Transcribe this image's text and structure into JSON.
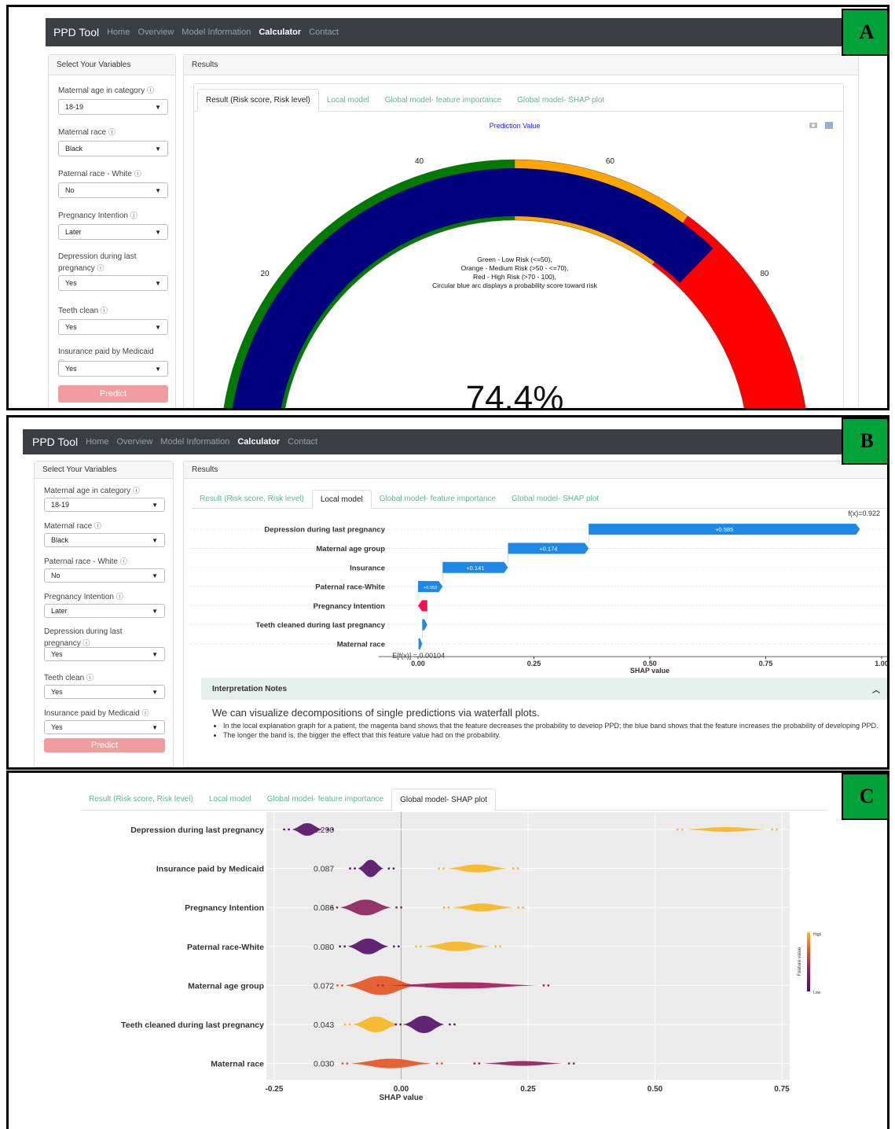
{
  "panels": {
    "a": {
      "letter": "A"
    },
    "b": {
      "letter": "B"
    },
    "c": {
      "letter": "C"
    }
  },
  "navbar": {
    "brand": "PPD Tool",
    "items": [
      "Home",
      "Overview",
      "Model Information",
      "Calculator",
      "Contact"
    ],
    "active": "Calculator"
  },
  "sidebar": {
    "title": "Select Your Variables",
    "info_icon": "ⓘ",
    "fields": [
      {
        "label": "Maternal age in category",
        "value": "18-19"
      },
      {
        "label": "Maternal race",
        "value": "Black"
      },
      {
        "label": "Paternal race - White",
        "value": "No"
      },
      {
        "label": "Pregnancy Intention",
        "value": "Later"
      },
      {
        "label": "Depression during last pregnancy",
        "value": "Yes"
      },
      {
        "label": "Teeth clean",
        "value": "Yes"
      },
      {
        "label": "Insurance paid by Medicaid",
        "value": "Yes"
      }
    ],
    "predict_label": "Predict"
  },
  "results": {
    "title": "Results",
    "tabs": [
      "Result (Risk score, Risk level)",
      "Local model",
      "Global model- feature importance",
      "Global model- SHAP plot"
    ]
  },
  "gauge": {
    "title": "Prediction Value",
    "value": 74.4,
    "value_text": "74.4%",
    "tick_labels": [
      "20",
      "40",
      "60",
      "80"
    ],
    "ranges": [
      {
        "from": 0,
        "to": 50,
        "color": "#007b00"
      },
      {
        "from": 50,
        "to": 70,
        "color": "#ffa500"
      },
      {
        "from": 70,
        "to": 100,
        "color": "#ff0000"
      }
    ],
    "bar_color": "#00007f",
    "legend_lines": [
      "Green - Low Risk (<=50),",
      "Orange - Medium Risk (>50 - <=70),",
      "Red - High Risk (>70 - 100),",
      "Circular blue arc displays a probability score toward risk"
    ],
    "toolbar_icons": [
      "camera-icon",
      "chart-icon"
    ]
  },
  "waterfall": {
    "fx_label": "f(x)=0.922",
    "base_label": "E[f(x)] = 0.00104",
    "xlabel": "SHAP value",
    "ticks": [
      "0.00",
      "0.25",
      "0.50",
      "0.75",
      "1.00"
    ],
    "colors": {
      "positive": "#1e88e5",
      "negative": "#ff0d57"
    }
  },
  "interpretation": {
    "header": "Interpretation Notes",
    "lead": "We can visualize decompositions of single predictions via waterfall plots.",
    "bullets": [
      "In the local explanation graph for a patient, the magenta band shows that the feature decreases the probability to develop PPD; the blue band shows that the feature increases the probability of developing PPD.",
      "The longer the band is, the bigger the effect that this feature value had on the probability."
    ]
  },
  "shap_summary": {
    "xlabel": "SHAP value",
    "ticks": [
      "-0.25",
      "0.00",
      "0.25",
      "0.50",
      "0.75"
    ],
    "colorbar_label": "Feature value",
    "colorbar_high": "High",
    "colorbar_low": "Low"
  },
  "chart_data": [
    {
      "type": "bar",
      "title": "",
      "xlabel": "SHAP value",
      "ylabel": "",
      "base_value": 0.00104,
      "final_value": 0.922,
      "xlim": [
        -0.02,
        1.05
      ],
      "categories": [
        "Depression during last pregnancy",
        "Maternal age group",
        "Insurance",
        "Paternal race-White",
        "Pregnancy Intention",
        "Teeth cleaned during last pregnancy",
        "Maternal race"
      ],
      "values": [
        0.585,
        0.174,
        0.141,
        0.053,
        -0.02,
        0.011,
        0.008
      ],
      "data_labels": [
        "+0.585",
        "+0.174",
        "+0.141",
        "+0.053",
        "",
        "",
        ""
      ]
    },
    {
      "type": "scatter",
      "title": "",
      "xlabel": "SHAP value",
      "ylabel": "",
      "xlim": [
        -0.25,
        0.75
      ],
      "categories": [
        "Depression during last pregnancy",
        "Insurance paid by Medicaid",
        "Pregnancy Intention",
        "Paternal race-White",
        "Maternal age group",
        "Teeth cleaned during last pregnancy",
        "Maternal race"
      ],
      "mean_abs_shap": [
        "0.290",
        "0.087",
        "0.086",
        "0.080",
        "0.072",
        "0.043",
        "0.030"
      ],
      "clusters": [
        [
          {
            "center": -0.185,
            "spread": 0.03,
            "thick": 8,
            "color": "#5b1a6e"
          },
          {
            "center": 0.64,
            "spread": 0.08,
            "thick": 3,
            "color": "#f5b82a"
          }
        ],
        [
          {
            "center": -0.06,
            "spread": 0.025,
            "thick": 11,
            "color": "#5b1a6e"
          },
          {
            "center": 0.15,
            "spread": 0.06,
            "thick": 5,
            "color": "#f5b82a"
          }
        ],
        [
          {
            "center": -0.07,
            "spread": 0.05,
            "thick": 10,
            "color": "#8e2b62"
          },
          {
            "center": 0.16,
            "spread": 0.06,
            "thick": 5,
            "color": "#f5b82a"
          }
        ],
        [
          {
            "center": -0.065,
            "spread": 0.04,
            "thick": 10,
            "color": "#5b1a6e"
          },
          {
            "center": 0.11,
            "spread": 0.065,
            "thick": 6,
            "color": "#f5b82a"
          }
        ],
        [
          {
            "center": -0.04,
            "spread": 0.07,
            "thick": 12,
            "color": "#e65a2a"
          },
          {
            "center": 0.12,
            "spread": 0.15,
            "thick": 4,
            "color": "#a8245e"
          }
        ],
        [
          {
            "center": -0.05,
            "spread": 0.045,
            "thick": 10,
            "color": "#f5b82a"
          },
          {
            "center": 0.045,
            "spread": 0.04,
            "thick": 11,
            "color": "#5b1a6e"
          }
        ],
        [
          {
            "center": -0.02,
            "spread": 0.08,
            "thick": 6,
            "color": "#e65a2a"
          },
          {
            "center": 0.24,
            "spread": 0.08,
            "thick": 3,
            "color": "#8e2b62"
          }
        ]
      ]
    }
  ]
}
